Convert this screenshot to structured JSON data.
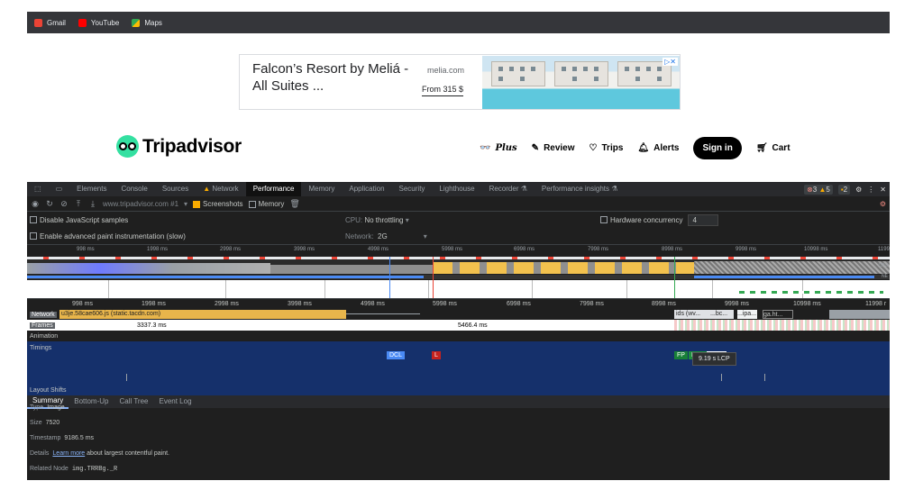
{
  "bookmarks": [
    {
      "label": "Gmail",
      "icon": "gmail-icon",
      "color": "#ea4335"
    },
    {
      "label": "YouTube",
      "icon": "youtube-icon",
      "color": "#ff0000"
    },
    {
      "label": "Maps",
      "icon": "maps-icon",
      "color": "#34a853"
    }
  ],
  "ad": {
    "title": "Falcon’s Resort by Meliá - All Suites ...",
    "domain": "melia.com",
    "price": "From 315 $",
    "adchoices": "▷✕"
  },
  "site": {
    "logo_text": "Tripadvisor",
    "nav": {
      "plus": "Plus",
      "review": "Review",
      "trips": "Trips",
      "alerts": "Alerts",
      "signin": "Sign in",
      "cart": "Cart"
    }
  },
  "devtools": {
    "tabs": [
      "Elements",
      "Console",
      "Sources",
      "Network",
      "Performance",
      "Memory",
      "Application",
      "Security",
      "Lighthouse",
      "Recorder ⚗",
      "Performance insights ⚗"
    ],
    "active_tab": "Performance",
    "status": {
      "errors": "3",
      "warnings": "5",
      "info": "2"
    },
    "toolbar": {
      "target": "www.tripadvisor.com #1",
      "screenshots_label": "Screenshots",
      "memory_label": "Memory"
    },
    "settings": {
      "disable_js_samples": "Disable JavaScript samples",
      "cpu_label": "CPU:",
      "cpu_value": "No throttling",
      "hw_concurrency_label": "Hardware concurrency",
      "hw_concurrency_value": "4",
      "advanced_paint": "Enable advanced paint instrumentation (slow)",
      "network_label": "Network:",
      "network_value": "2G"
    },
    "overview_ticks": [
      "998 ms",
      "1998 ms",
      "2998 ms",
      "3998 ms",
      "4998 ms",
      "5998 ms",
      "6998 ms",
      "7998 ms",
      "8998 ms",
      "9998 ms",
      "10998 ms",
      "1199"
    ],
    "overview_side": {
      "cpu": "CPU",
      "net": "NE"
    },
    "ruler_ticks": [
      "998 ms",
      "1998 ms",
      "2998 ms",
      "3998 ms",
      "4998 ms",
      "5998 ms",
      "6998 ms",
      "7998 ms",
      "8998 ms",
      "9998 ms",
      "10998 ms",
      "11998 r"
    ],
    "tracks": {
      "network": "Network",
      "network_request": "u3je.58cae606.js (static.tacdn.com)",
      "network_small": [
        "ids (wv...",
        "...bc...",
        "...ipa...",
        "ga.ht..."
      ],
      "frames": "Frames",
      "frame_a": "3337.3 ms",
      "frame_b": "5466.4 ms",
      "animation": "Animation",
      "timings": "Timings",
      "layout_shifts": "Layout Shifts"
    },
    "markers": {
      "dcl": "DCL",
      "l": "L",
      "fp": "FP",
      "fcp": "FCP",
      "lcp": "LCP"
    },
    "tooltip": "9.19 s  LCP",
    "bottom_tabs": [
      "Summary",
      "Bottom-Up",
      "Call Tree",
      "Event Log"
    ],
    "summary": {
      "type_label": "Type",
      "type_value": "Image",
      "size_label": "Size",
      "size_value": "7520",
      "timestamp_label": "Timestamp",
      "timestamp_value": "9186.5 ms",
      "details_label": "Details",
      "details_link": "Learn more",
      "details_rest": "about largest contentful paint.",
      "node_label": "Related Node",
      "node_value": "img.TRRBg._R"
    }
  }
}
